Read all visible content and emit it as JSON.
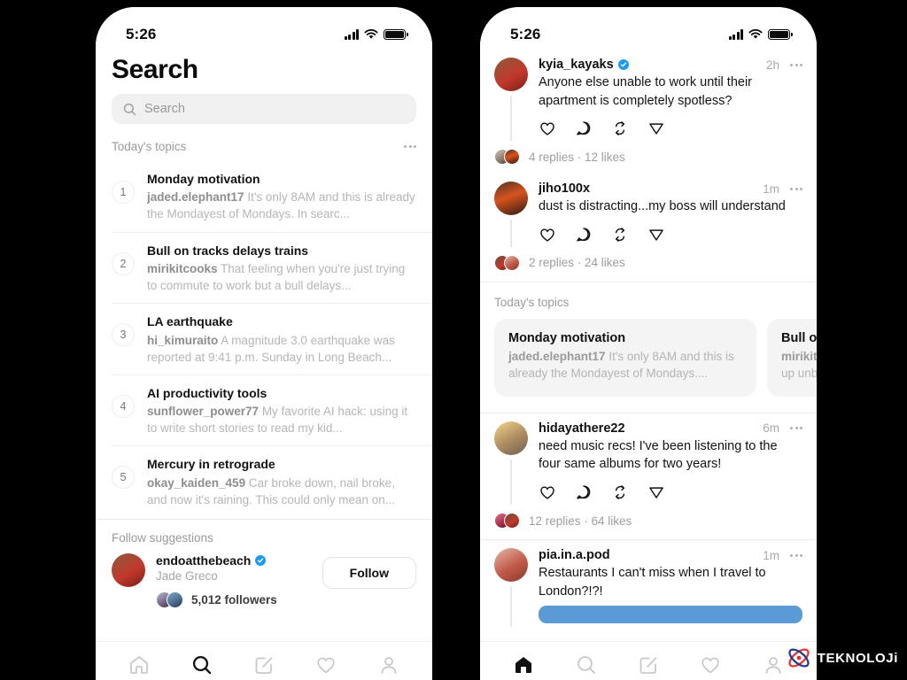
{
  "watermark": {
    "text": "TEKNOLOJi",
    "logo_icon": "atom-logo-icon",
    "red": "#e8322d",
    "blue": "#1f3a93"
  },
  "left_phone": {
    "status": {
      "time": "5:26",
      "signal_icon": "cellular-bars-icon",
      "wifi_icon": "wifi-icon",
      "battery_icon": "battery-full-icon"
    },
    "title": "Search",
    "search": {
      "placeholder": "Search",
      "icon": "search-icon"
    },
    "topics_header": {
      "label": "Today's topics",
      "more_icon": "more-horizontal-icon"
    },
    "topics": [
      {
        "rank": "1",
        "title": "Monday motivation",
        "user": "jaded.elephant17",
        "snippet": "It's only 8AM and this is already the Mondayest of Mondays. In searc..."
      },
      {
        "rank": "2",
        "title": "Bull on tracks delays trains",
        "user": "mirikitcooks",
        "snippet": "That feeling when you're just trying to commute to work but a bull delays..."
      },
      {
        "rank": "3",
        "title": "LA earthquake",
        "user": "hi_kimuraito",
        "snippet": "A magnitude 3.0 earthquake was reported at 9:41 p.m. Sunday in Long Beach..."
      },
      {
        "rank": "4",
        "title": "AI productivity tools",
        "user": "sunflower_power77",
        "snippet": "My favorite AI hack: using it to write short stories to read my kid..."
      },
      {
        "rank": "5",
        "title": "Mercury in retrograde",
        "user": "okay_kaiden_459",
        "snippet": "Car broke down, nail broke, and now it's raining. This could only mean on..."
      }
    ],
    "follow_header": "Follow suggestions",
    "follow_suggestion": {
      "username": "endoatthebeach",
      "verified": true,
      "display_name": "Jade Greco",
      "followers": "5,012 followers",
      "button_label": "Follow",
      "avatar_icon": "user-avatar"
    },
    "tabs": [
      {
        "name": "home",
        "icon": "home-icon",
        "active": false
      },
      {
        "name": "search",
        "icon": "search-icon",
        "active": true
      },
      {
        "name": "compose",
        "icon": "compose-icon",
        "active": false
      },
      {
        "name": "activity",
        "icon": "heart-icon",
        "active": false
      },
      {
        "name": "profile",
        "icon": "person-icon",
        "active": false
      }
    ]
  },
  "right_phone": {
    "status": {
      "time": "5:26",
      "signal_icon": "cellular-bars-icon",
      "wifi_icon": "wifi-icon",
      "battery_icon": "battery-full-icon"
    },
    "posts_top": [
      {
        "username": "kyia_kayaks",
        "verified": true,
        "time": "2h",
        "text": "Anyone else unable to work until their apartment is completely spotless?",
        "stats": "4 replies · 12 likes",
        "avatar_icon": "user-avatar",
        "actions": [
          "heart-icon",
          "comment-icon",
          "repost-icon",
          "share-icon"
        ],
        "more_icon": "more-horizontal-icon"
      },
      {
        "username": "jiho100x",
        "verified": false,
        "time": "1m",
        "text": "dust is distracting...my boss will understand",
        "stats": "2 replies · 24 likes",
        "avatar_icon": "user-avatar",
        "actions": [
          "heart-icon",
          "comment-icon",
          "repost-icon",
          "share-icon"
        ],
        "more_icon": "more-horizontal-icon"
      }
    ],
    "topics_label": "Today's topics",
    "topic_cards": [
      {
        "title": "Monday motivation",
        "user": "jaded.elephant17",
        "snippet": "It's only 8AM and this is already the Mondayest of Mondays...."
      },
      {
        "title": "Bull on",
        "user": "mirikitc",
        "snippet": "up unb"
      }
    ],
    "posts_bottom": [
      {
        "username": "hidayathere22",
        "verified": false,
        "time": "6m",
        "text": "need music recs! I've been listening to the four same albums for two years!",
        "stats": "12 replies · 64 likes",
        "avatar_icon": "user-avatar",
        "actions": [
          "heart-icon",
          "comment-icon",
          "repost-icon",
          "share-icon"
        ],
        "more_icon": "more-horizontal-icon"
      },
      {
        "username": "pia.in.a.pod",
        "verified": false,
        "time": "1m",
        "text": "Restaurants I can't miss when I travel to London?!?!",
        "stats": "",
        "avatar_icon": "user-avatar",
        "actions": [],
        "more_icon": "more-horizontal-icon",
        "attachment_color": "#5b9bd5"
      }
    ],
    "tabs": [
      {
        "name": "home",
        "icon": "home-icon",
        "active": true
      },
      {
        "name": "search",
        "icon": "search-icon",
        "active": false
      },
      {
        "name": "compose",
        "icon": "compose-icon",
        "active": false
      },
      {
        "name": "activity",
        "icon": "heart-icon",
        "active": false
      },
      {
        "name": "profile",
        "icon": "person-icon",
        "active": false
      }
    ]
  }
}
